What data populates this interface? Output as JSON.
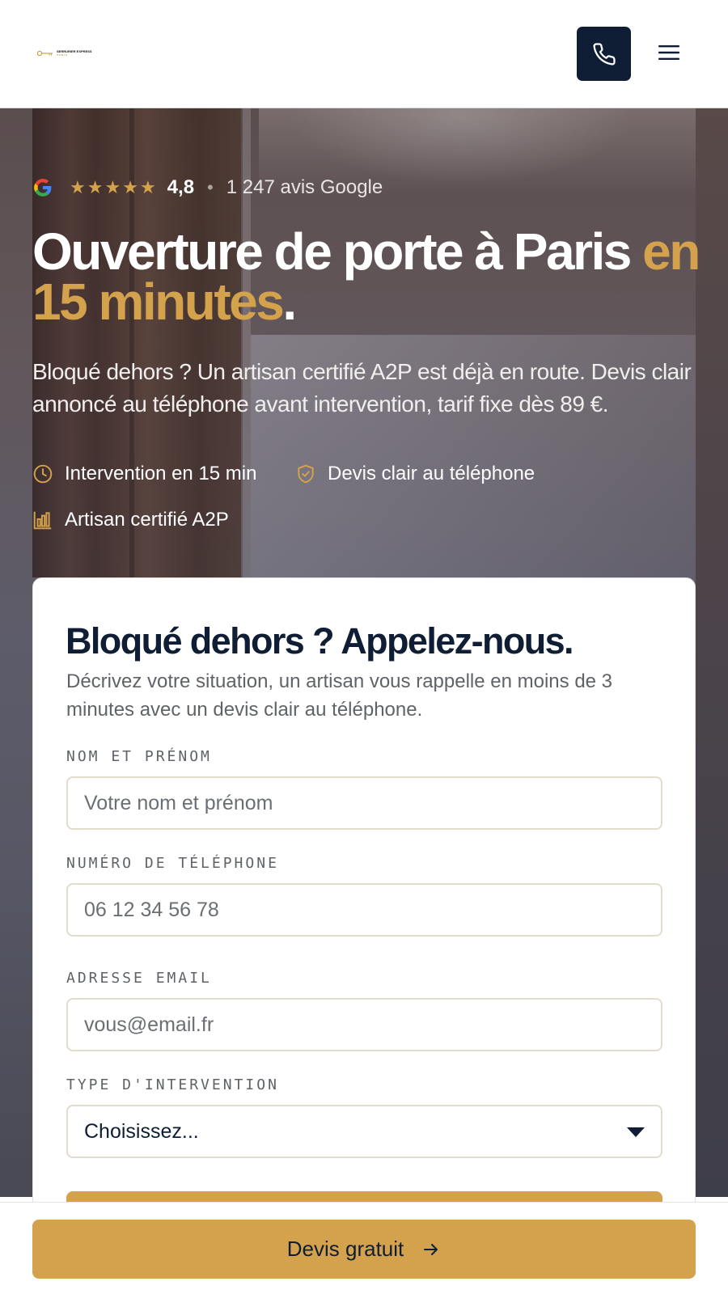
{
  "header": {
    "logo_text": "SERRURIER EXPRESS",
    "logo_subtext": "PARIS",
    "call_icon": "phone-icon",
    "menu_icon": "hamburger-menu-icon"
  },
  "hero": {
    "rating": {
      "provider_icon": "google-icon",
      "stars": 4.8,
      "score": "4,8",
      "separator": "•",
      "count_text": "1 247 avis Google"
    },
    "headline": {
      "main": "Ouverture de porte à Paris ",
      "accent": "en 15 minutes",
      "end": "."
    },
    "subtitle": "Bloqué dehors ? Un artisan certifié A2P est déjà en route. Devis clair annoncé au téléphone avant intervention, tarif fixe dès 89 €.",
    "features": [
      {
        "icon": "clock-icon",
        "label": "Intervention en 15 min"
      },
      {
        "icon": "shield-check-icon",
        "label": "Devis clair au téléphone"
      },
      {
        "icon": "bar-chart-icon",
        "label": "Artisan certifié A2P"
      }
    ]
  },
  "form": {
    "title": "Bloqué dehors ? Appelez-nous.",
    "description": "Décrivez votre situation, un artisan vous rappelle en moins de 3 minutes avec un devis clair au téléphone.",
    "name": {
      "label": "NOM ET PRÉNOM",
      "placeholder": "Votre nom et prénom"
    },
    "phone": {
      "label": "NUMÉRO DE TÉLÉPHONE",
      "placeholder": "06 12 34 56 78"
    },
    "email": {
      "label": "ADRESSE EMAIL",
      "placeholder": "vous@email.fr"
    },
    "type": {
      "label": "TYPE D'INTERVENTION",
      "selected": "Choisissez..."
    }
  },
  "sticky_cta": {
    "label": "Devis gratuit",
    "icon": "arrow-right-icon"
  },
  "colors": {
    "accent": "#d4a24c",
    "navy": "#0f1e35",
    "muted": "#5f6368"
  }
}
